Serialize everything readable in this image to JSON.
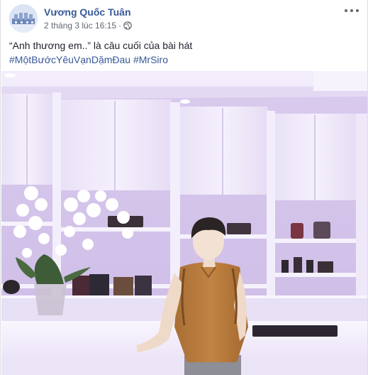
{
  "post": {
    "author": "Vương Quốc Tuân",
    "timestamp": "2 tháng 3 lúc 16:15",
    "separator": "·",
    "privacy_icon": "globe-icon",
    "more_icon": "more-options-icon",
    "text_line1": "“Anh thương em..” là câu cuối của bài hát",
    "hashtags": [
      "#MộtBướcYêuVạnDặmĐau",
      "#MrSiro"
    ],
    "photo": {
      "description_icon": "post-photo",
      "colors": {
        "wall": "#e6dcf4",
        "cabinet": "#f4effc",
        "shirt": "#b77a3c",
        "counter": "#f7f3fd"
      }
    }
  },
  "colors": {
    "link": "#385898",
    "text": "#1d2129",
    "meta": "#616770",
    "background": "#ffffff",
    "page": "#e9ebee"
  }
}
